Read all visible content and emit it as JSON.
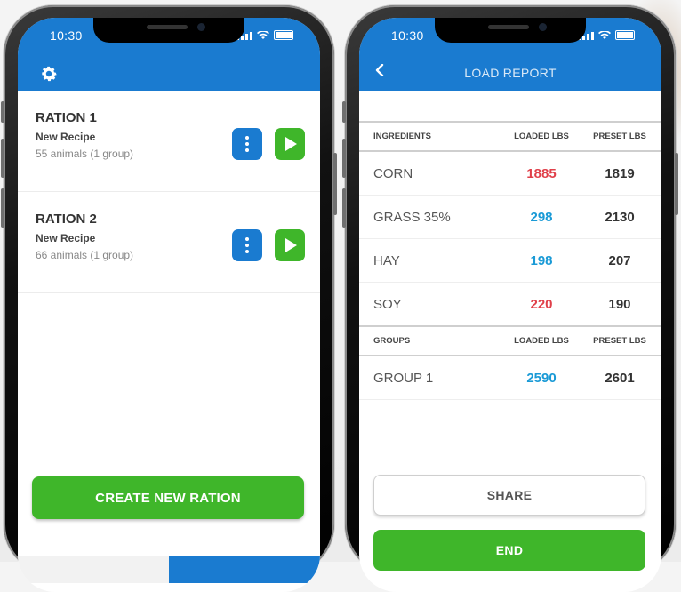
{
  "colors": {
    "primary_blue": "#1a7bd0",
    "action_green": "#3fb62a",
    "over_red": "#e0404a",
    "under_blue": "#1a9ad6"
  },
  "left_screen": {
    "status_time": "10:30",
    "settings_icon": "gear-icon",
    "rations": [
      {
        "title": "RATION 1",
        "recipe": "New Recipe",
        "animals": "55 animals (1 group)"
      },
      {
        "title": "RATION 2",
        "recipe": "New Recipe",
        "animals": "66 animals (1 group)"
      }
    ],
    "create_button": "CREATE NEW RATION"
  },
  "right_screen": {
    "status_time": "10:30",
    "title": "LOAD REPORT",
    "ingredients_header": {
      "name": "INGREDIENTS",
      "loaded": "LOADED LBS",
      "preset": "PRESET LBS"
    },
    "ingredients": [
      {
        "name": "CORN",
        "loaded": "1885",
        "preset": "1819",
        "status": "over"
      },
      {
        "name": "GRASS 35%",
        "loaded": "298",
        "preset": "2130",
        "status": "under"
      },
      {
        "name": "HAY",
        "loaded": "198",
        "preset": "207",
        "status": "under"
      },
      {
        "name": "SOY",
        "loaded": "220",
        "preset": "190",
        "status": "over"
      }
    ],
    "groups_header": {
      "name": "GROUPS",
      "loaded": "LOADED LBS",
      "preset": "PRESET LBS"
    },
    "groups": [
      {
        "name": "GROUP 1",
        "loaded": "2590",
        "preset": "2601",
        "status": "under"
      }
    ],
    "share_button": "SHARE",
    "end_button": "END"
  }
}
